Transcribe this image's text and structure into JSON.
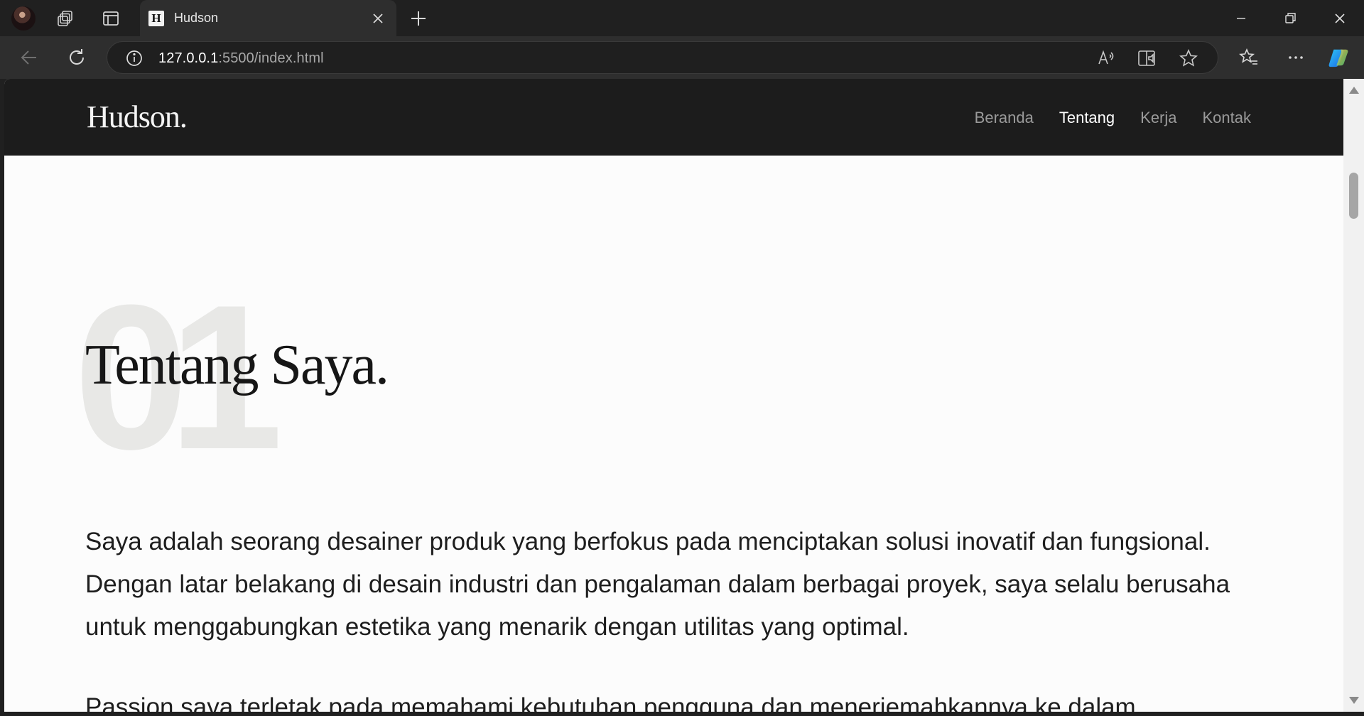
{
  "browser": {
    "tab": {
      "favicon_letter": "H",
      "title": "Hudson"
    },
    "address": {
      "host": "127.0.0.1",
      "rest": ":5500/index.html"
    }
  },
  "site": {
    "logo": "Hudson.",
    "nav": [
      {
        "label": "Beranda",
        "active": false
      },
      {
        "label": "Tentang",
        "active": true
      },
      {
        "label": "Kerja",
        "active": false
      },
      {
        "label": "Kontak",
        "active": false
      }
    ],
    "section": {
      "number": "01",
      "title": "Tentang Saya.",
      "paragraphs": [
        "Saya adalah seorang desainer produk yang berfokus pada menciptakan solusi inovatif dan fungsional. Dengan latar belakang di desain industri dan pengalaman dalam berbagai proyek, saya selalu berusaha untuk menggabungkan estetika yang menarik dengan utilitas yang optimal.",
        "Passion saya terletak pada memahami kebutuhan pengguna dan menerjemahkannya ke dalam"
      ]
    }
  },
  "colors": {
    "nav_bg": "#1c1c1c",
    "page_bg": "#fcfcfc",
    "chrome_bg": "#202020",
    "active_nav": "#ffffff",
    "inactive_nav": "#9a9a9a"
  }
}
